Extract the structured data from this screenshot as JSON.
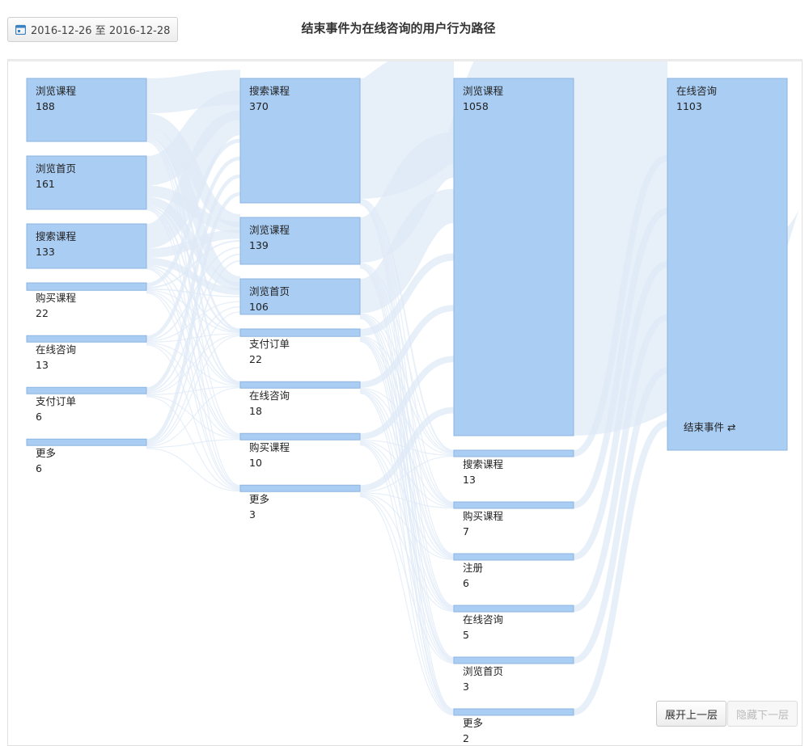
{
  "header": {
    "date_range": "2016-12-26 至 2016-12-28",
    "title": "结束事件为在线咨询的用户行为路径"
  },
  "controls": {
    "expand_label": "展开上一层",
    "hide_label": "隐藏下一层"
  },
  "chart_data": {
    "type": "sankey",
    "title": "结束事件为在线咨询的用户行为路径",
    "end_event_label": "结束事件",
    "colors": {
      "node": "#a9cdf3",
      "link": "#dfe9f7",
      "border": "#8db5e0"
    },
    "columns": [
      {
        "nodes": [
          {
            "name": "浏览课程",
            "value": 188
          },
          {
            "name": "浏览首页",
            "value": 161
          },
          {
            "name": "搜索课程",
            "value": 133
          },
          {
            "name": "购买课程",
            "value": 22
          },
          {
            "name": "在线咨询",
            "value": 13
          },
          {
            "name": "支付订单",
            "value": 6
          },
          {
            "name": "更多",
            "value": 6
          }
        ]
      },
      {
        "nodes": [
          {
            "name": "搜索课程",
            "value": 370
          },
          {
            "name": "浏览课程",
            "value": 139
          },
          {
            "name": "浏览首页",
            "value": 106
          },
          {
            "name": "支付订单",
            "value": 22
          },
          {
            "name": "在线咨询",
            "value": 18
          },
          {
            "name": "购买课程",
            "value": 10
          },
          {
            "name": "更多",
            "value": 3
          }
        ]
      },
      {
        "nodes": [
          {
            "name": "浏览课程",
            "value": 1058
          },
          {
            "name": "搜索课程",
            "value": 13
          },
          {
            "name": "购买课程",
            "value": 7
          },
          {
            "name": "注册",
            "value": 6
          },
          {
            "name": "在线咨询",
            "value": 5
          },
          {
            "name": "浏览首页",
            "value": 3
          },
          {
            "name": "更多",
            "value": 2
          }
        ]
      },
      {
        "nodes": [
          {
            "name": "在线咨询",
            "value": 1103
          }
        ]
      }
    ]
  }
}
